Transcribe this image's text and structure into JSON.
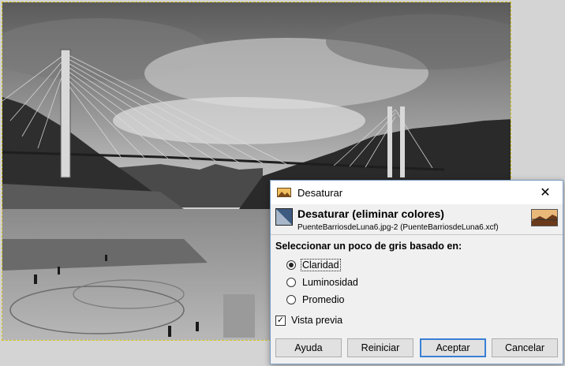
{
  "dialog": {
    "window_title": "Desaturar",
    "header_title": "Desaturar (eliminar colores)",
    "header_subtitle": "PuenteBarriosdeLuna6.jpg-2 (PuenteBarriosdeLuna6.xcf)",
    "section_label": "Seleccionar un poco de gris basado en:",
    "options": [
      {
        "label": "Claridad",
        "checked": true
      },
      {
        "label": "Luminosidad",
        "checked": false
      },
      {
        "label": "Promedio",
        "checked": false
      }
    ],
    "preview_label": "Vista previa",
    "preview_checked": true,
    "buttons": {
      "help": "Ayuda",
      "reset": "Reiniciar",
      "accept": "Aceptar",
      "cancel": "Cancelar"
    }
  },
  "icons": {
    "window": "image-landscape-icon",
    "header": "desaturate-icon",
    "close": "close-icon",
    "checkmark": "✓"
  },
  "colors": {
    "accent": "#3a7fd6",
    "selection_border": "#d9c21a"
  }
}
